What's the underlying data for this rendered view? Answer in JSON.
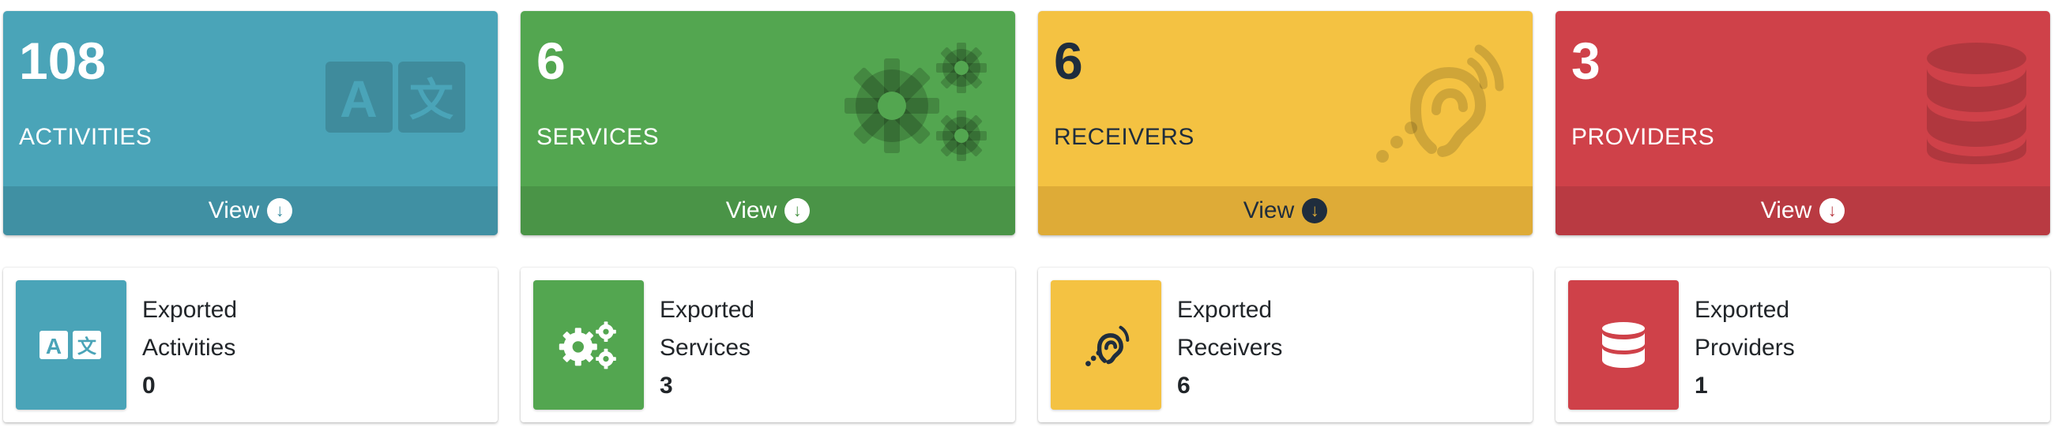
{
  "cards": [
    {
      "count": "108",
      "label": "ACTIVITIES",
      "view_label": "View",
      "icon": "language-icon",
      "color": "#4aa4b8"
    },
    {
      "count": "6",
      "label": "SERVICES",
      "view_label": "View",
      "icon": "cogs-icon",
      "color": "#53a650"
    },
    {
      "count": "6",
      "label": "RECEIVERS",
      "view_label": "View",
      "icon": "assistive-listening-icon",
      "color": "#f4c242"
    },
    {
      "count": "3",
      "label": "PROVIDERS",
      "view_label": "View",
      "icon": "database-icon",
      "color": "#cf4149"
    }
  ],
  "exported": [
    {
      "line1": "Exported",
      "line2": "Activities",
      "value": "0",
      "icon": "language-icon"
    },
    {
      "line1": "Exported",
      "line2": "Services",
      "value": "3",
      "icon": "cogs-icon"
    },
    {
      "line1": "Exported",
      "line2": "Receivers",
      "value": "6",
      "icon": "assistive-listening-icon"
    },
    {
      "line1": "Exported",
      "line2": "Providers",
      "value": "1",
      "icon": "database-icon"
    }
  ]
}
